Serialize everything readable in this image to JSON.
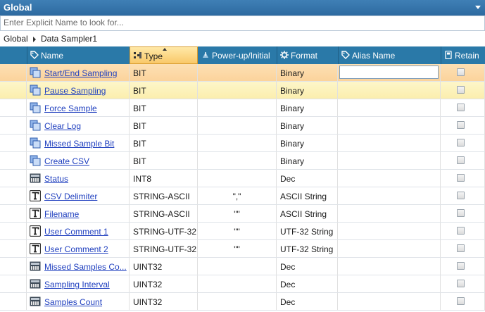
{
  "panel": {
    "title": "Global"
  },
  "search": {
    "placeholder": "Enter Explicit Name to look for..."
  },
  "breadcrumb": {
    "root": "Global",
    "current": "Data Sampler1"
  },
  "columns": {
    "name": "Name",
    "type": "Type",
    "powerup": "Power-up/Initial",
    "format": "Format",
    "alias": "Alias Name",
    "retain": "Retain"
  },
  "sort": {
    "column": "Type",
    "direction": "ascending"
  },
  "rows": [
    {
      "name": "Start/End Sampling",
      "type": "BIT",
      "powerup": "",
      "format": "Binary",
      "icon": "command-icon",
      "retain": false,
      "state": "selected"
    },
    {
      "name": "Pause Sampling",
      "type": "BIT",
      "powerup": "",
      "format": "Binary",
      "icon": "command-icon",
      "retain": false,
      "state": "hover"
    },
    {
      "name": "Force Sample",
      "type": "BIT",
      "powerup": "",
      "format": "Binary",
      "icon": "command-icon",
      "retain": false,
      "state": ""
    },
    {
      "name": "Clear Log",
      "type": "BIT",
      "powerup": "",
      "format": "Binary",
      "icon": "command-icon",
      "retain": false,
      "state": ""
    },
    {
      "name": "Missed Sample Bit",
      "type": "BIT",
      "powerup": "",
      "format": "Binary",
      "icon": "command-icon",
      "retain": false,
      "state": ""
    },
    {
      "name": "Create CSV",
      "type": "BIT",
      "powerup": "",
      "format": "Binary",
      "icon": "command-icon",
      "retain": false,
      "state": ""
    },
    {
      "name": "Status",
      "type": "INT8",
      "powerup": "",
      "format": "Dec",
      "icon": "numeric-icon",
      "retain": false,
      "state": ""
    },
    {
      "name": "CSV Delimiter",
      "type": "STRING-ASCII",
      "powerup": "\",\"",
      "format": "ASCII String",
      "icon": "text-icon",
      "retain": false,
      "state": ""
    },
    {
      "name": "Filename",
      "type": "STRING-ASCII",
      "powerup": "\"\"",
      "format": "ASCII String",
      "icon": "text-icon",
      "retain": false,
      "state": ""
    },
    {
      "name": "User Comment 1",
      "type": "STRING-UTF-32",
      "powerup": "\"\"",
      "format": "UTF-32 String",
      "icon": "text-icon",
      "retain": false,
      "state": ""
    },
    {
      "name": "User Comment 2",
      "type": "STRING-UTF-32",
      "powerup": "\"\"",
      "format": "UTF-32 String",
      "icon": "text-icon",
      "retain": false,
      "state": ""
    },
    {
      "name": "Missed Samples Co...",
      "type": "UINT32",
      "powerup": "",
      "format": "Dec",
      "icon": "numeric-icon",
      "retain": false,
      "state": ""
    },
    {
      "name": "Sampling Interval",
      "type": "UINT32",
      "powerup": "",
      "format": "Dec",
      "icon": "numeric-icon",
      "retain": false,
      "state": ""
    },
    {
      "name": "Samples Count",
      "type": "UINT32",
      "powerup": "",
      "format": "Dec",
      "icon": "numeric-icon",
      "retain": false,
      "state": ""
    }
  ],
  "colors": {
    "header": "#2a79a8",
    "title_bar": "#2d6aa0",
    "selected_row": "#fbd39c",
    "hover_row": "#fbeeae",
    "link": "#1f3fbf"
  }
}
